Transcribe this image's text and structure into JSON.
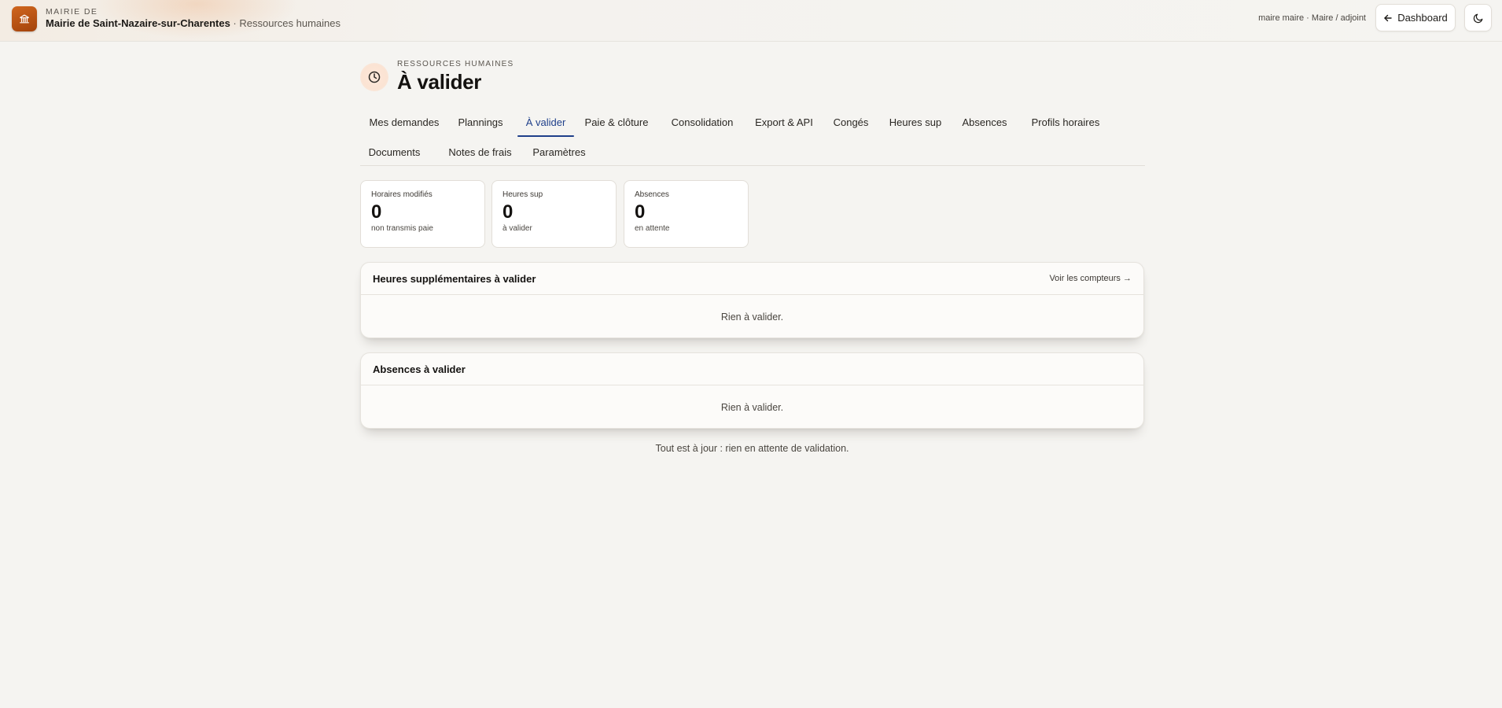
{
  "topbar": {
    "kicker": "MAIRIE DE",
    "town": "Mairie de Saint-Nazaire-sur-Charentes",
    "separator": " · ",
    "module": "Ressources humaines",
    "user": "maire maire · Maire / adjoint",
    "dashboard_label": "Dashboard",
    "icons": {
      "logo": "town-hall-icon",
      "back": "arrow-left-icon",
      "theme": "moon-icon"
    },
    "colors": {
      "logo": "#c05a18"
    }
  },
  "header": {
    "kicker": "RESSOURCES HUMAINES",
    "title": "À valider",
    "icon": "clock-icon"
  },
  "tabs": [
    {
      "label": "Mes demandes",
      "active": false
    },
    {
      "label": "Plannings",
      "active": false
    },
    {
      "label": "À valider",
      "active": true
    },
    {
      "label": "Paie & clôture",
      "active": false
    },
    {
      "label": "Consolidation",
      "active": false
    },
    {
      "label": "Export & API",
      "active": false
    },
    {
      "label": "Congés",
      "active": false
    },
    {
      "label": "Heures sup",
      "active": false
    },
    {
      "label": "Absences",
      "active": false
    },
    {
      "label": "Profils horaires",
      "active": false
    },
    {
      "label": "Documents",
      "active": false
    },
    {
      "label": "Notes de frais",
      "active": false
    },
    {
      "label": "Paramètres",
      "active": false
    }
  ],
  "stats": [
    {
      "label": "Horaires modifiés",
      "value": "0",
      "sub": "non transmis paie"
    },
    {
      "label": "Heures sup",
      "value": "0",
      "sub": "à valider"
    },
    {
      "label": "Absences",
      "value": "0",
      "sub": "en attente"
    }
  ],
  "panels": {
    "overtime": {
      "title": "Heures supplémentaires à valider",
      "link": "Voir les compteurs →",
      "empty": "Rien à valider."
    },
    "absences": {
      "title": "Absences à valider",
      "empty": "Rien à valider."
    }
  },
  "footer": "Tout est à jour : rien en attente de validation.",
  "colors": {
    "accent": "#1f3f8a",
    "background": "#f5f4f1"
  }
}
